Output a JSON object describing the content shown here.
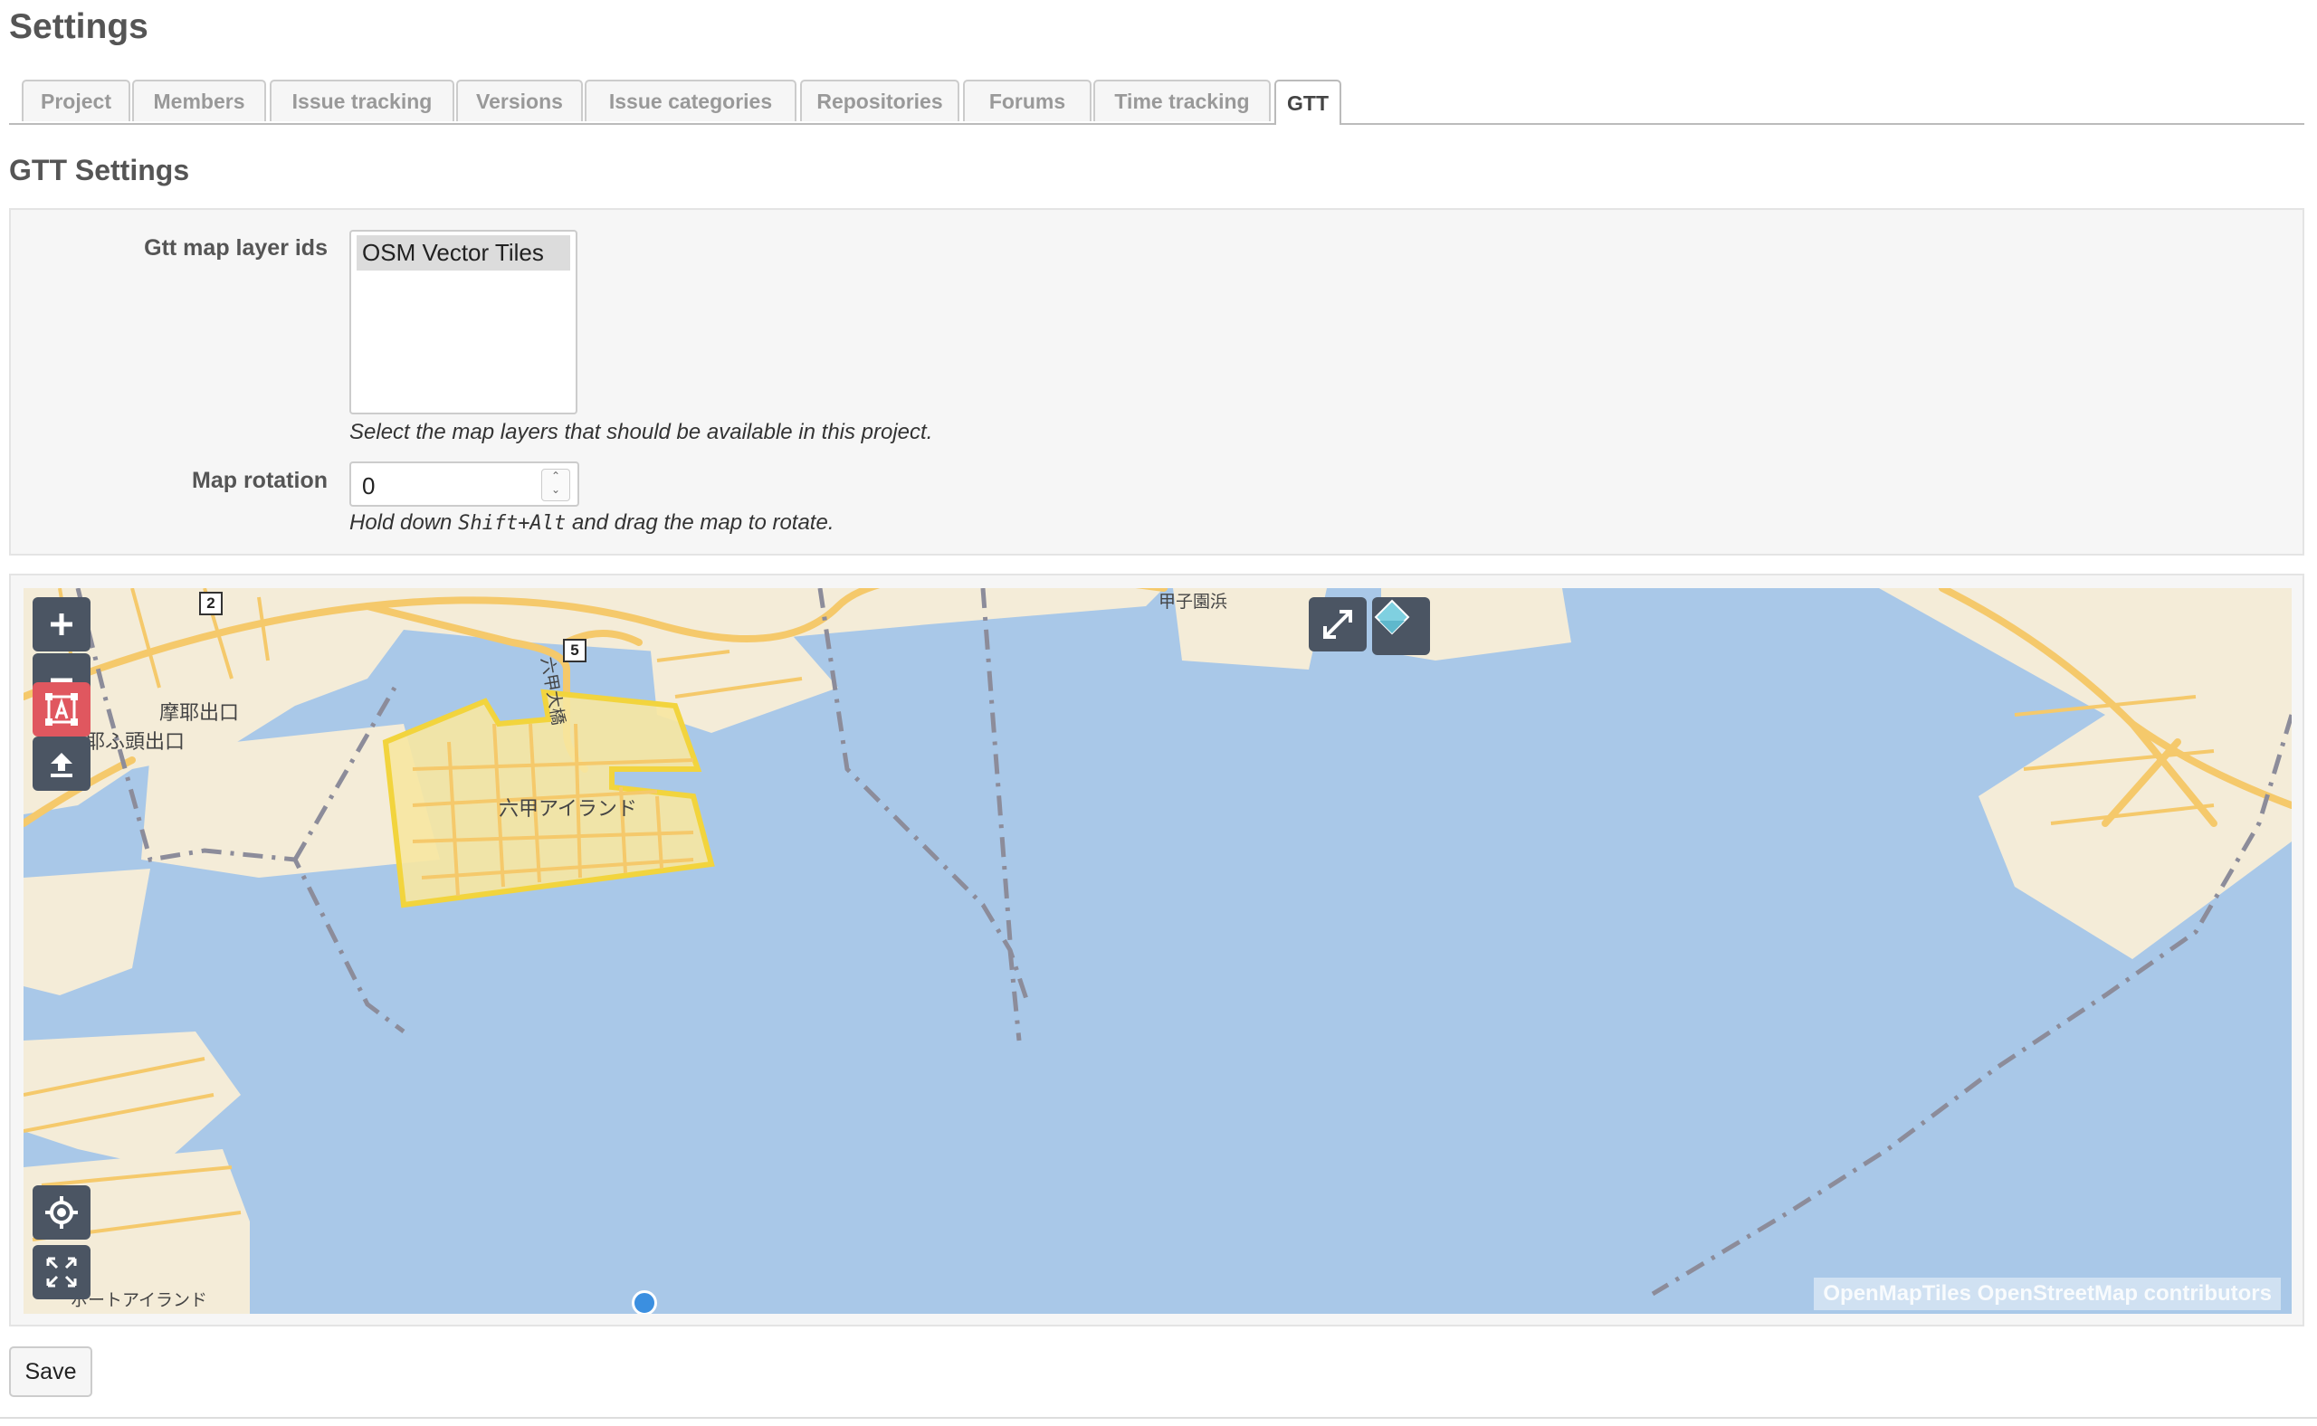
{
  "page": {
    "title": "Settings"
  },
  "tabs": [
    {
      "label": "Project"
    },
    {
      "label": "Members"
    },
    {
      "label": "Issue tracking"
    },
    {
      "label": "Versions"
    },
    {
      "label": "Issue categories"
    },
    {
      "label": "Repositories"
    },
    {
      "label": "Forums"
    },
    {
      "label": "Time tracking"
    },
    {
      "label": "GTT",
      "selected": true
    }
  ],
  "gtt": {
    "section_title": "GTT Settings",
    "layer_ids": {
      "label": "Gtt map layer ids",
      "selected_option": "OSM Vector Tiles",
      "hint": "Select the map layers that should be available in this project."
    },
    "rotation": {
      "label": "Map rotation",
      "value": "0",
      "hint_prefix": "Hold down",
      "hint_code": "Shift+Alt",
      "hint_suffix": "and drag the map to rotate."
    }
  },
  "map": {
    "labels": {
      "island": "六甲アイランド",
      "bridge": "六甲大橋",
      "exit1": "摩耶出口",
      "exit2": "摩耶ふ頭出口",
      "port_island": "ポートアイランド",
      "koshien": "甲子園浜"
    },
    "route_shields": [
      "2",
      "5"
    ],
    "attribution": "OpenMapTiles OpenStreetMap contributors",
    "controls": {
      "zoom_in": "zoom-in-icon",
      "zoom_out": "zoom-out-icon",
      "draw": "draw-polygon-icon",
      "upload": "upload-icon",
      "geolocate": "geolocate-icon",
      "fit": "fit-extent-icon",
      "fullscreen": "fullscreen-icon",
      "layers": "layers-icon"
    },
    "colors": {
      "water": "#a9c8e8",
      "land": "#f4ecd8",
      "road": "#f5c96b",
      "selection_fill": "#f7e7a1",
      "selection_stroke": "#f2d43d",
      "boundary": "#8c8c9a"
    }
  },
  "form": {
    "save_label": "Save"
  }
}
